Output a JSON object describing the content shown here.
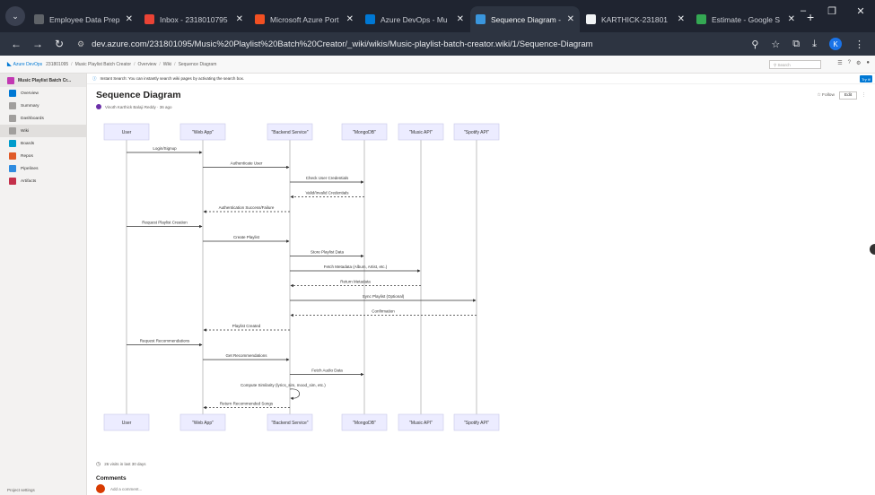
{
  "browser": {
    "tabs": [
      {
        "title": "Employee Data Prep",
        "favicon_color": "#5f6368"
      },
      {
        "title": "Inbox - 2318010795",
        "favicon_color": "#ea4335"
      },
      {
        "title": "Microsoft Azure Port",
        "favicon_color": "#f25022"
      },
      {
        "title": "Azure DevOps - Mu",
        "favicon_color": "#0078d4"
      },
      {
        "title": "Sequence Diagram -",
        "favicon_color": "#3a96dd",
        "active": true
      },
      {
        "title": "KARTHICK-231801",
        "favicon_color": "#f1f3f4"
      },
      {
        "title": "Estimate - Google S",
        "favicon_color": "#34a853"
      }
    ],
    "new_tab": "+",
    "url": "dev.azure.com/231801095/Music%20Playlist%20Batch%20Creator/_wiki/wikis/Music-playlist-batch-creator.wiki/1/Sequence-Diagram",
    "profile_initial": "K"
  },
  "ado": {
    "brand": "Azure DevOps",
    "breadcrumb": [
      "231801095",
      "Music Playlist Batch Creator",
      "Overview",
      "Wiki",
      "Sequence Diagram"
    ],
    "search_placeholder": "Search"
  },
  "sidebar": {
    "project": "Music Playlist Batch Cr...",
    "items": [
      {
        "label": "Overview",
        "color": "#0078d4"
      },
      {
        "label": "Summary",
        "color": "#a19f9d"
      },
      {
        "label": "Dashboards",
        "color": "#a19f9d"
      },
      {
        "label": "Wiki",
        "color": "#a19f9d",
        "selected": true
      },
      {
        "label": "Boards",
        "color": "#009ccc"
      },
      {
        "label": "Repos",
        "color": "#e05a28"
      },
      {
        "label": "Pipelines",
        "color": "#2f8ce0"
      },
      {
        "label": "Artifacts",
        "color": "#c4314b"
      }
    ],
    "footer": "Project settings"
  },
  "page": {
    "banner": "Instant Search: You can instantly search wiki pages by activating the search box.",
    "try_label": "Try it!",
    "title": "Sequence Diagram",
    "author": "Vinoth Karthick Balaji Reddy · 36 ago",
    "follow_label": "Follow",
    "edit_label": "Edit",
    "views": "26 visits in last 30 days",
    "comments_title": "Comments",
    "comment_placeholder": "Add a comment..."
  },
  "diagram": {
    "participants": [
      "User",
      "\"Web App\"",
      "\"Backend Service\"",
      "\"MongoDB\"",
      "\"Music API\"",
      "\"Spotify API\""
    ],
    "messages": [
      {
        "from": 0,
        "to": 1,
        "label": "Login/Signup",
        "style": "solid"
      },
      {
        "from": 1,
        "to": 2,
        "label": "Authenticate User",
        "style": "solid"
      },
      {
        "from": 2,
        "to": 3,
        "label": "Check User Credentials",
        "style": "solid"
      },
      {
        "from": 3,
        "to": 2,
        "label": "Valid/Invalid Credentials",
        "style": "dashed"
      },
      {
        "from": 2,
        "to": 1,
        "label": "Authentication Success/Failure",
        "style": "dashed"
      },
      {
        "from": 0,
        "to": 1,
        "label": "Request Playlist Creation",
        "style": "solid"
      },
      {
        "from": 1,
        "to": 2,
        "label": "Create Playlist",
        "style": "solid"
      },
      {
        "from": 2,
        "to": 3,
        "label": "Store Playlist Data",
        "style": "solid"
      },
      {
        "from": 2,
        "to": 4,
        "label": "Fetch Metadata (Album, Artist, etc.)",
        "style": "solid"
      },
      {
        "from": 4,
        "to": 2,
        "label": "Return Metadata",
        "style": "dashed"
      },
      {
        "from": 2,
        "to": 5,
        "label": "Sync Playlist (Optional)",
        "style": "solid"
      },
      {
        "from": 5,
        "to": 2,
        "label": "Confirmation",
        "style": "dashed"
      },
      {
        "from": 2,
        "to": 1,
        "label": "Playlist Created",
        "style": "dashed"
      },
      {
        "from": 0,
        "to": 1,
        "label": "Request Recommendations",
        "style": "solid"
      },
      {
        "from": 1,
        "to": 2,
        "label": "Get Recommendations",
        "style": "solid"
      },
      {
        "from": 2,
        "to": 3,
        "label": "Fetch Audio Data",
        "style": "solid"
      },
      {
        "from": 2,
        "to": 2,
        "label": "Compute Similarity (lyrics_sim, mood_sim, etc.)",
        "style": "self"
      },
      {
        "from": 2,
        "to": 1,
        "label": "Return Recommended Songs",
        "style": "dashed"
      }
    ]
  }
}
